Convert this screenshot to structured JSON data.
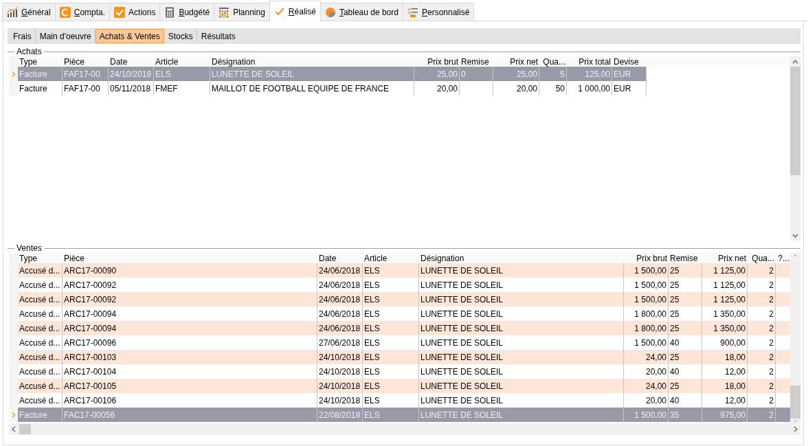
{
  "tabs": [
    {
      "label": "Général",
      "mnemonic": true,
      "selected": false
    },
    {
      "label": "Compta.",
      "mnemonic": true,
      "selected": false
    },
    {
      "label": "Actions",
      "mnemonic": false,
      "selected": false
    },
    {
      "label": "Budgété",
      "mnemonic": true,
      "selected": false
    },
    {
      "label": "Planning",
      "mnemonic": false,
      "selected": false
    },
    {
      "label": "Réalisé",
      "mnemonic": true,
      "selected": true
    },
    {
      "label": "Tableau de bord",
      "mnemonic": true,
      "selected": false
    },
    {
      "label": "Personnalisé",
      "mnemonic": true,
      "selected": false
    }
  ],
  "subtabs": [
    {
      "label": "Frais",
      "selected": false
    },
    {
      "label": "Main d'oeuvre",
      "selected": false
    },
    {
      "label": "Achats & Ventes",
      "selected": true
    },
    {
      "label": "Stocks",
      "selected": false
    },
    {
      "label": "Résultats",
      "selected": false
    }
  ],
  "achats": {
    "title": "Achats",
    "columns": [
      "Type",
      "Pièce",
      "Date",
      "Article",
      "Désignation",
      "Prix brut",
      "Remise",
      "Prix net",
      "Qua...",
      "Prix total",
      "Devise"
    ],
    "rows": [
      {
        "selected": true,
        "cells": [
          "Facture",
          "FAF17-00",
          "24/10/2018",
          "ELS",
          "LUNETTE DE SOLEIL",
          "25,00",
          "0",
          "25,00",
          "5",
          "125,00",
          "EUR"
        ]
      },
      {
        "selected": false,
        "cells": [
          "Facture",
          "FAF17-00",
          "05/11/2018",
          "FMEF",
          "MAILLOT DE FOOTBALL EQUIPE DE FRANCE",
          "20,00",
          "",
          "20,00",
          "50",
          "1 000,00",
          "EUR"
        ]
      }
    ]
  },
  "ventes": {
    "title": "Ventes",
    "columns": [
      "Type",
      "Pièce",
      "Date",
      "Article",
      "Désignation",
      "Prix brut",
      "Remise",
      "Prix net",
      "Qua...",
      "?..."
    ],
    "rows": [
      {
        "selected": false,
        "cells": [
          "Accusé d...",
          "ARC17-00090",
          "24/06/2018",
          "ELS",
          "LUNETTE DE SOLEIL",
          "1 500,00",
          "25",
          "1 125,00",
          "2",
          ""
        ]
      },
      {
        "selected": false,
        "cells": [
          "Accusé d...",
          "ARC17-00092",
          "24/06/2018",
          "ELS",
          "LUNETTE DE SOLEIL",
          "1 500,00",
          "25",
          "1 125,00",
          "2",
          ""
        ]
      },
      {
        "selected": false,
        "cells": [
          "Accusé d...",
          "ARC17-00092",
          "24/06/2018",
          "ELS",
          "LUNETTE DE SOLEIL",
          "1 500,00",
          "25",
          "1 125,00",
          "2",
          ""
        ]
      },
      {
        "selected": false,
        "cells": [
          "Accusé d...",
          "ARC17-00094",
          "24/06/2018",
          "ELS",
          "LUNETTE DE SOLEIL",
          "1 800,00",
          "25",
          "1 350,00",
          "2",
          ""
        ]
      },
      {
        "selected": false,
        "cells": [
          "Accusé d...",
          "ARC17-00094",
          "24/06/2018",
          "ELS",
          "LUNETTE DE SOLEIL",
          "1 800,00",
          "25",
          "1 350,00",
          "2",
          ""
        ]
      },
      {
        "selected": false,
        "cells": [
          "Accusé d...",
          "ARC17-00096",
          "27/06/2018",
          "ELS",
          "LUNETTE DE SOLEIL",
          "1 500,00",
          "40",
          "900,00",
          "2",
          ""
        ]
      },
      {
        "selected": false,
        "cells": [
          "Accusé d...",
          "ARC17-00103",
          "24/10/2018",
          "ELS",
          "LUNETTE DE SOLEIL",
          "24,00",
          "25",
          "18,00",
          "2",
          ""
        ]
      },
      {
        "selected": false,
        "cells": [
          "Accusé d...",
          "ARC17-00104",
          "24/10/2018",
          "ELS",
          "LUNETTE DE SOLEIL",
          "20,00",
          "40",
          "12,00",
          "2",
          ""
        ]
      },
      {
        "selected": false,
        "cells": [
          "Accusé d...",
          "ARC17-00105",
          "24/10/2018",
          "ELS",
          "LUNETTE DE SOLEIL",
          "24,00",
          "25",
          "18,00",
          "2",
          ""
        ]
      },
      {
        "selected": false,
        "cells": [
          "Accusé d...",
          "ARC17-00106",
          "24/10/2018",
          "ELS",
          "LUNETTE DE SOLEIL",
          "20,00",
          "40",
          "12,00",
          "2",
          ""
        ]
      },
      {
        "selected": true,
        "cells": [
          "Facture",
          "FAC17-00056",
          "22/08/2018",
          "ELS",
          "LUNETTE DE SOLEIL",
          "1 500,00",
          "35",
          "975,00",
          "2",
          ""
        ]
      }
    ]
  }
}
